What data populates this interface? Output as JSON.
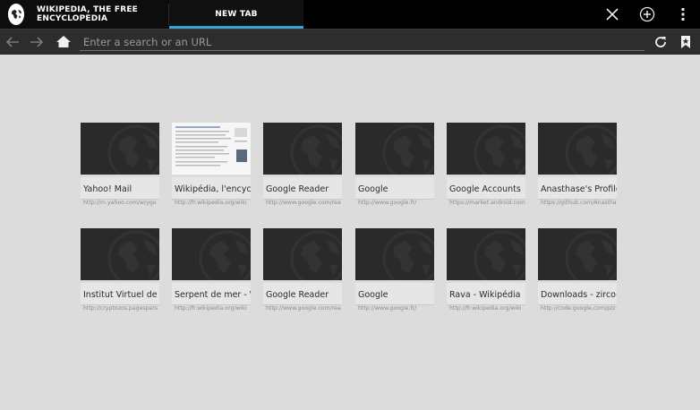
{
  "tabs": [
    {
      "label": "WIKIPEDIA, THE FREE ENCYCLOPEDIA",
      "icon": "wikipedia-globe-icon"
    },
    {
      "label": "NEW TAB",
      "active": true
    }
  ],
  "toolbar": {
    "close_icon": "close-icon",
    "new_tab_icon": "add-tab-icon",
    "menu_icon": "overflow-menu-icon"
  },
  "urlbar": {
    "placeholder": "Enter a search or an URL"
  },
  "accent_color": "#36a3d7",
  "most_visited": [
    {
      "title": "Yahoo! Mail",
      "url": "http://m.yahoo.com/w/ygo"
    },
    {
      "title": "Wikipédia, l'encyclop",
      "url": "http://fr.wikipedia.org/wiki"
    },
    {
      "title": "Google Reader",
      "url": "http://www.google.com/rea"
    },
    {
      "title": "Google",
      "url": "http://www.google.fr/"
    },
    {
      "title": "Google Accounts",
      "url": "https://market.android.com"
    },
    {
      "title": "Anasthase's Profile -",
      "url": "https://github.com/Anasthas"
    },
    {
      "title": "Institut Virtuel de Cryp",
      "url": "http://cryptozos.pagespers"
    },
    {
      "title": "Serpent de mer - Wiki",
      "url": "http://fr.wikipedia.org/wiki"
    },
    {
      "title": "Google Reader",
      "url": "http://www.google.com/rea"
    },
    {
      "title": "Google",
      "url": "http://www.google.fr/"
    },
    {
      "title": "Rava - Wikipédia",
      "url": "http://fr.wikipedia.org/wiki"
    },
    {
      "title": "Downloads - zirco-br",
      "url": "http://code.google.com/p/z"
    }
  ]
}
